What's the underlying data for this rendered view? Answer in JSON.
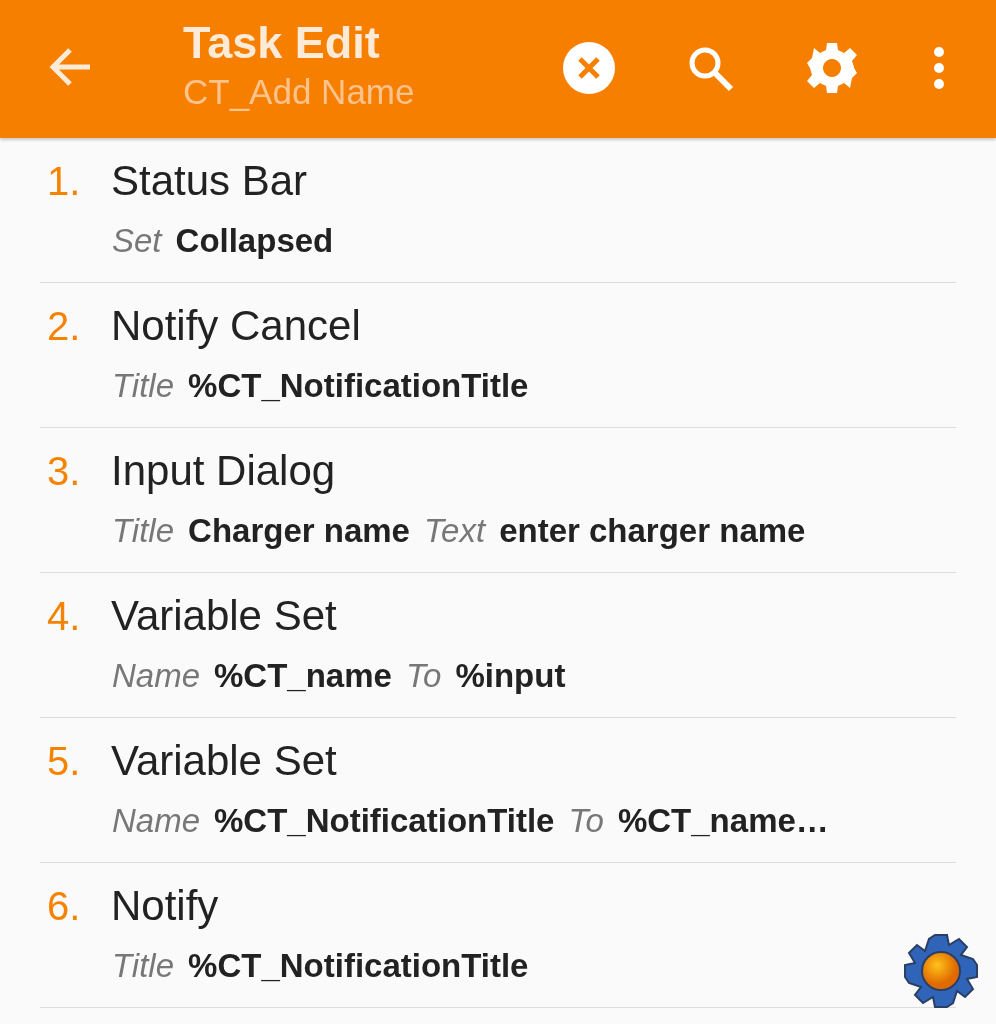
{
  "app_bar": {
    "title": "Task Edit",
    "subtitle": "CT_Add Name"
  },
  "actions": [
    {
      "number": "1.",
      "name": "Status Bar",
      "params": [
        {
          "label": "Set",
          "value": "Collapsed"
        }
      ]
    },
    {
      "number": "2.",
      "name": "Notify Cancel",
      "params": [
        {
          "label": "Title",
          "value": "%CT_NotificationTitle"
        }
      ]
    },
    {
      "number": "3.",
      "name": "Input Dialog",
      "params": [
        {
          "label": "Title",
          "value": "Charger name"
        },
        {
          "label": "Text",
          "value": "enter charger name"
        }
      ]
    },
    {
      "number": "4.",
      "name": "Variable Set",
      "params": [
        {
          "label": "Name",
          "value": "%CT_name"
        },
        {
          "label": "To",
          "value": "%input"
        }
      ]
    },
    {
      "number": "5.",
      "name": "Variable Set",
      "params": [
        {
          "label": "Name",
          "value": "%CT_NotificationTitle"
        },
        {
          "label": "To",
          "value": "%CT_name…"
        }
      ]
    },
    {
      "number": "6.",
      "name": "Notify",
      "params": [
        {
          "label": "Title",
          "value": "%CT_NotificationTitle"
        }
      ]
    }
  ]
}
